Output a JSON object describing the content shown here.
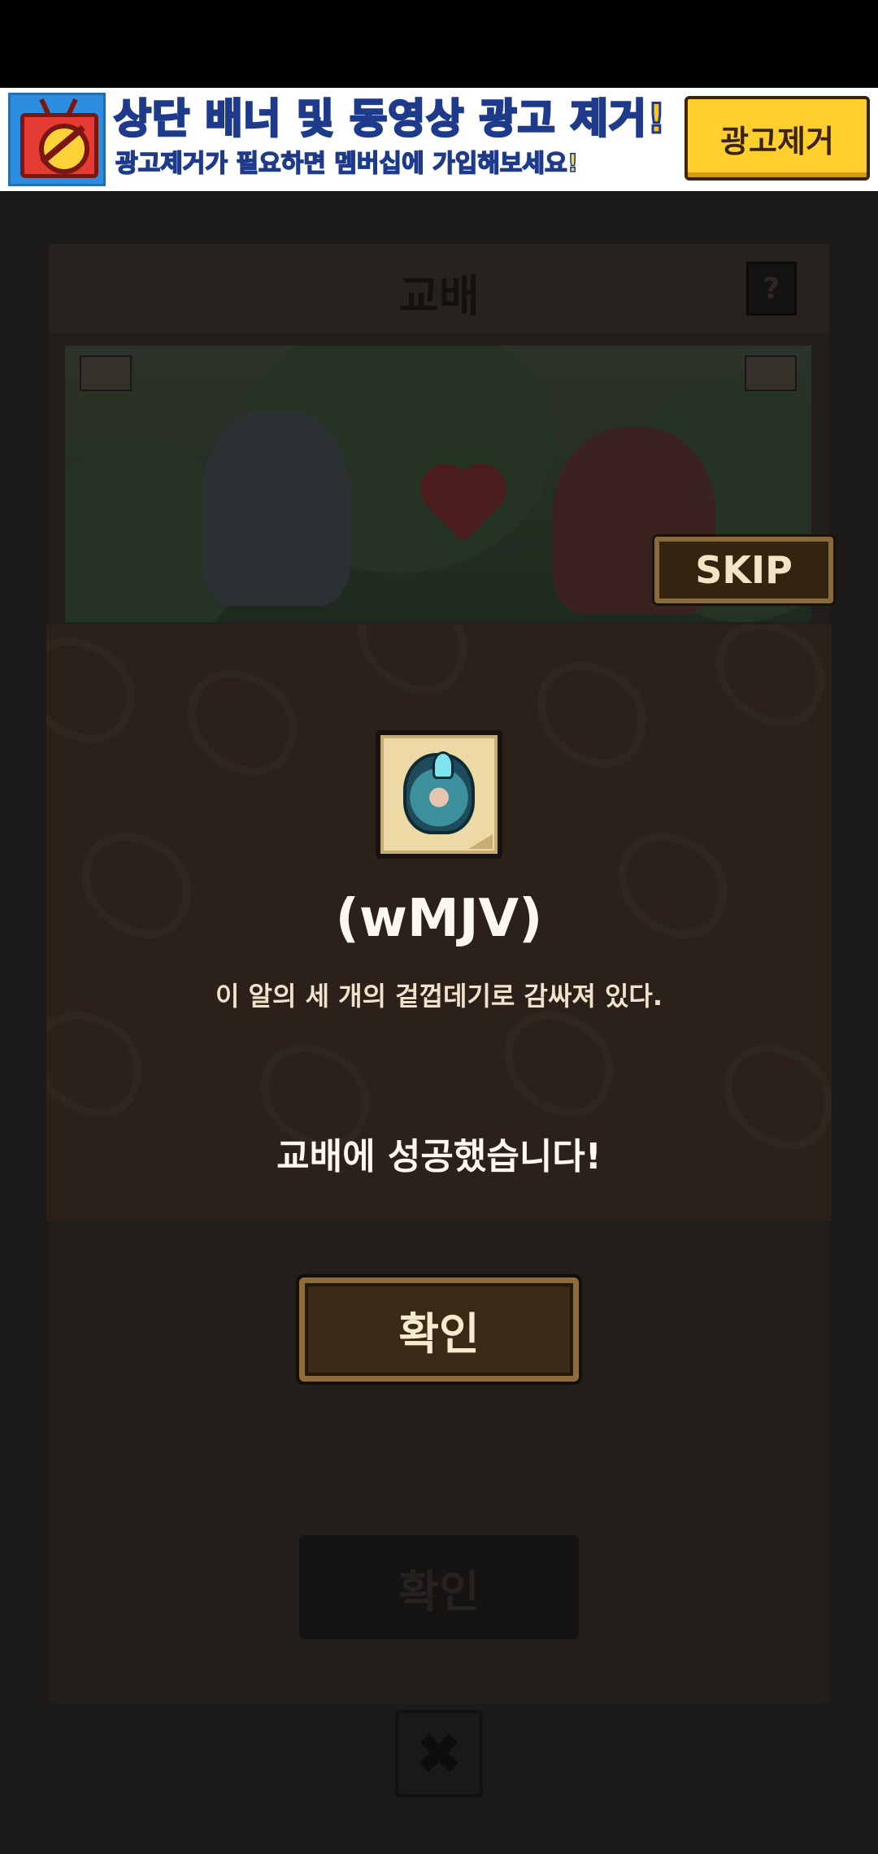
{
  "ad_banner": {
    "title": "상단 배너 및 동영상 광고 제거!",
    "subtitle": "광고제거가 필요하면 멤버십에 가입해보세요!",
    "remove_button": "광고제거",
    "icon": "no-ad-tv-icon"
  },
  "game": {
    "panel_title": "교배",
    "help_label": "?",
    "skip_label": "SKIP",
    "confirm_label_background": "확인",
    "close_label": "✖"
  },
  "dialog": {
    "item_icon": "egg-item-icon",
    "item_name": "(wMJV)",
    "item_description": "이 알의 세 개의 겉껍데기로 감싸져 있다.",
    "result_message": "교배에 성공했습니다!",
    "confirm_label": "확인"
  },
  "colors": {
    "ad_title": "#ffc21f",
    "ad_button": "#ffcf2e",
    "dialog_bg": "#2b211a",
    "button_wood": "#3a2914",
    "button_border": "#8e6c3a"
  }
}
